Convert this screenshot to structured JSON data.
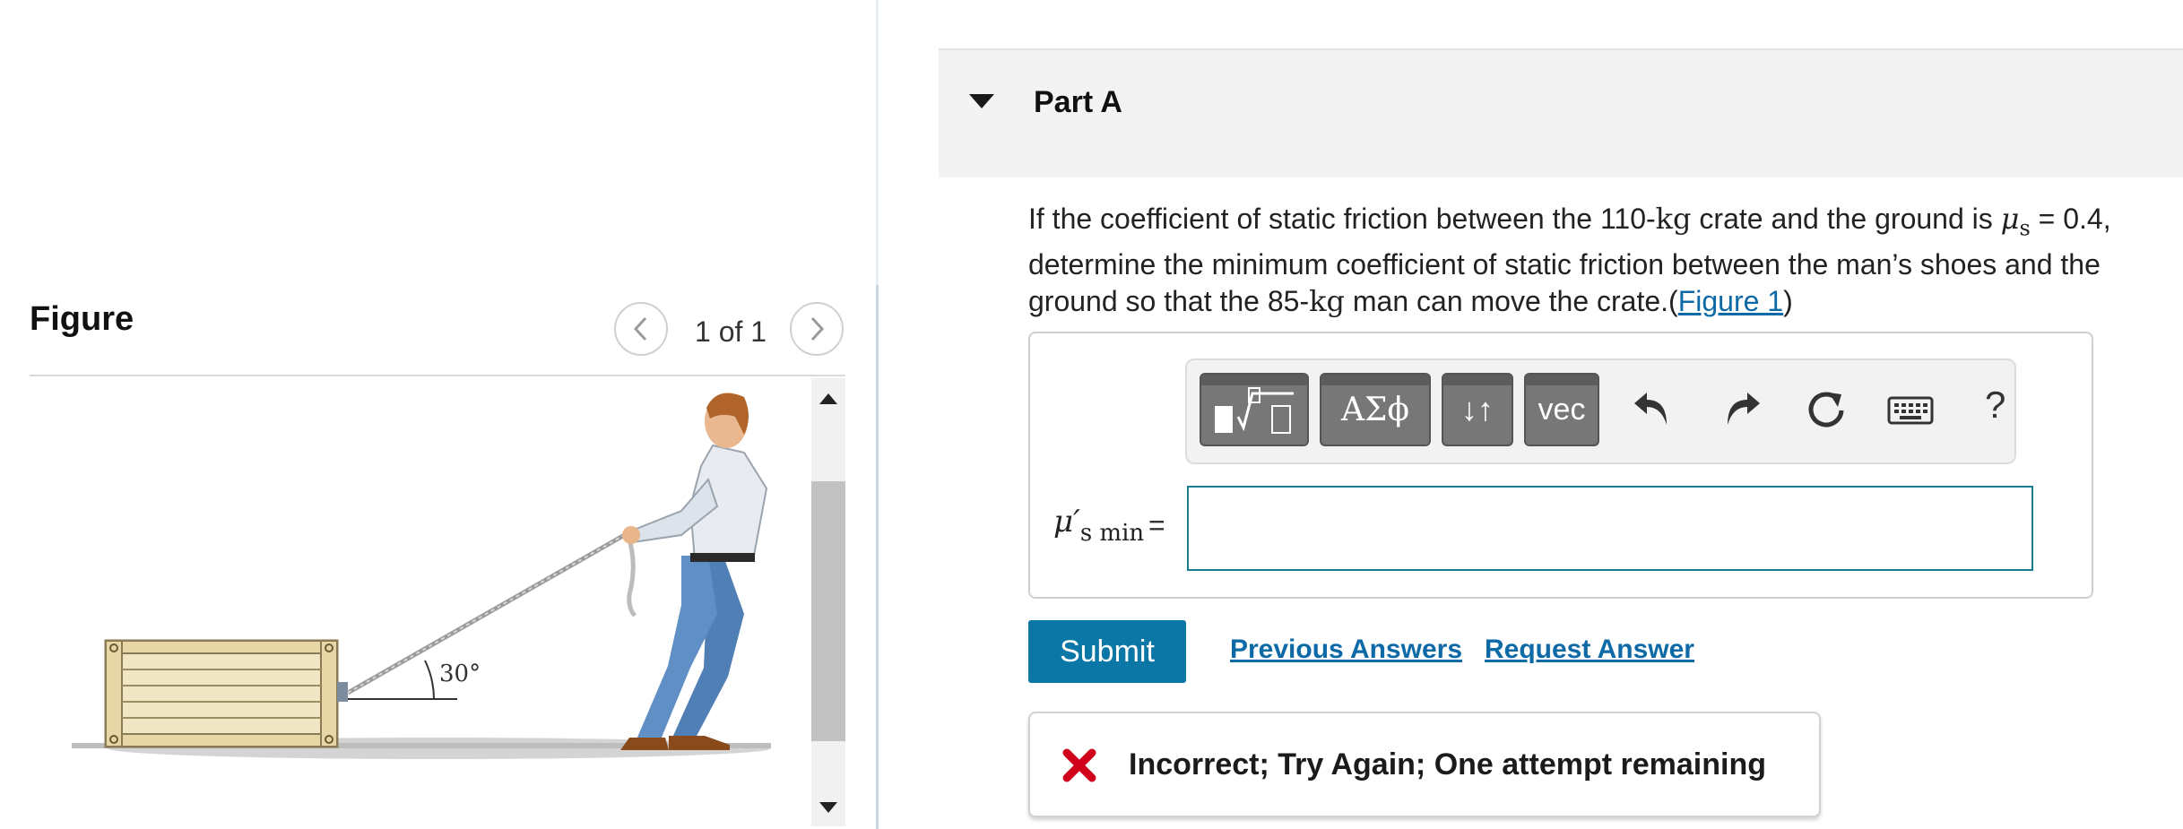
{
  "figure": {
    "title": "Figure",
    "counter": "1 of 1",
    "angle_label": "30°"
  },
  "part": {
    "title": "Part A"
  },
  "question": {
    "t1": "If the coefficient of static friction between the 110-",
    "kg1": "kg",
    "t2": " crate and the ground is ",
    "mu": "μ",
    "mu_sub": "s",
    "t3": " = 0.4, determine the minimum coefficient of static friction between the man’s shoes and the ground so that the 85-",
    "kg2": "kg",
    "t4": " man can move the crate.(",
    "figure_link": "Figure 1",
    "t5": ")"
  },
  "toolbar": {
    "greek_label": "ΑΣϕ",
    "arrows_label": "↓↑",
    "vec_label": "vec",
    "help_label": "?",
    "icons": [
      "template-icon",
      "undo-icon",
      "redo-icon",
      "reset-icon",
      "keyboard-icon"
    ]
  },
  "answer": {
    "var_symbol": "μ′",
    "var_sub": "s min",
    "equals": "=",
    "value": ""
  },
  "actions": {
    "submit": "Submit",
    "previous_answers": "Previous Answers",
    "request_answer": "Request Answer"
  },
  "feedback": {
    "text": "Incorrect; Try Again; One attempt remaining",
    "status_color": "#d0021b"
  },
  "colors": {
    "accent": "#0b77a6",
    "link": "#0e6aa6",
    "input_border": "#1a7d8f"
  }
}
